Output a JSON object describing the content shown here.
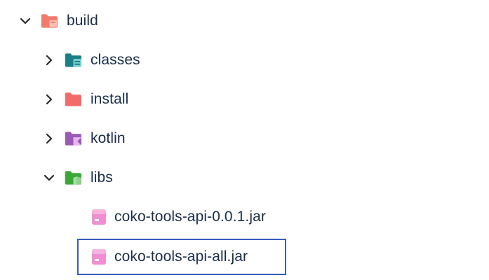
{
  "tree": {
    "build": {
      "label": "build",
      "expanded": true,
      "icon": "folder-open-icon",
      "color": "#f27b6b"
    },
    "classes": {
      "label": "classes",
      "expanded": false,
      "icon": "folder-classes-icon",
      "color": "#1a7f86"
    },
    "install": {
      "label": "install",
      "expanded": false,
      "icon": "folder-icon",
      "color": "#f26b6b"
    },
    "kotlin": {
      "label": "kotlin",
      "expanded": false,
      "icon": "folder-kotlin-icon",
      "color": "#9b59b6"
    },
    "libs": {
      "label": "libs",
      "expanded": true,
      "icon": "folder-libs-icon",
      "color": "#3aa835"
    },
    "files": [
      {
        "label": "coko-tools-api-0.0.1.jar",
        "icon": "jar-file-icon",
        "color": "#ef8fd0",
        "selected": false
      },
      {
        "label": "coko-tools-api-all.jar",
        "icon": "jar-file-icon",
        "color": "#ef8fd0",
        "selected": true
      }
    ]
  },
  "colors": {
    "text": "#1a2d4a",
    "selection_border": "#3a5bbf"
  }
}
